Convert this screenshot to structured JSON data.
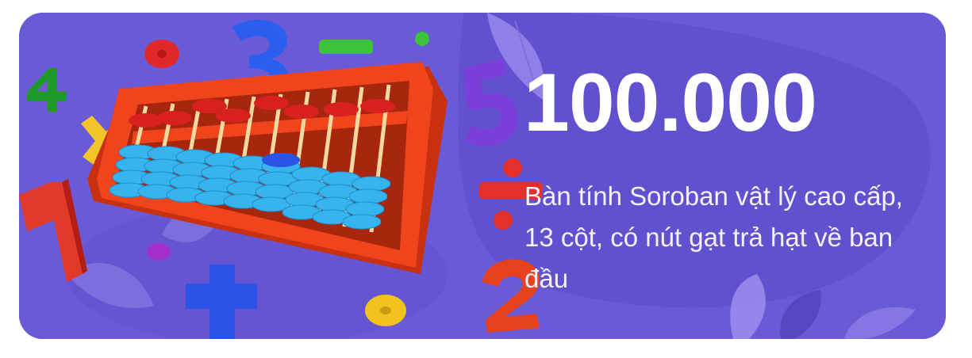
{
  "card": {
    "amount": "100.000",
    "description": "Bàn tính Soroban vật lý cao cấp, 13 cột, có nút gạt trả hạt về ban đầu"
  },
  "colors": {
    "background": "#6a5ad6",
    "background_blob": "#5b4bc8",
    "abacus_frame": "#f0441c",
    "bead_red": "#d8211f",
    "bead_blue": "#37b3ee",
    "rod": "#f3d9a0",
    "text": "#ffffff"
  },
  "decorations": {
    "abacus_columns": 13,
    "floating_digits": [
      "4",
      "3",
      "1",
      "5",
      "2"
    ],
    "floating_symbols": [
      "minus-icon",
      "plus-icon",
      "times-icon",
      "divide-icon"
    ]
  }
}
